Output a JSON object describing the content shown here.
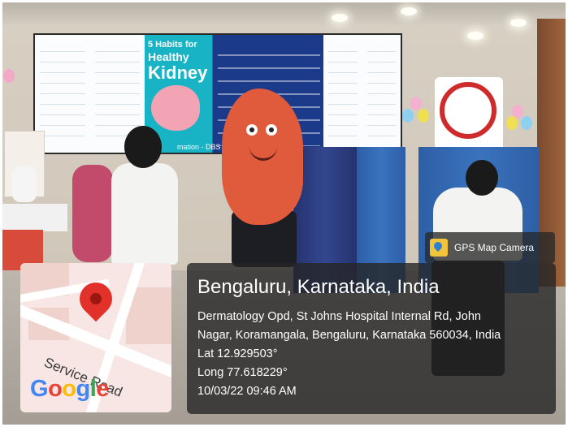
{
  "overlay": {
    "app_tag": {
      "logo_icon": "gps-map-camera-logo",
      "label": "GPS Map Camera"
    },
    "map": {
      "pin_icon": "map-pin-icon",
      "road_label": "Service Road",
      "brand": [
        {
          "ch": "G",
          "color": "#4285F4"
        },
        {
          "ch": "o",
          "color": "#EA4335"
        },
        {
          "ch": "o",
          "color": "#FBBC05"
        },
        {
          "ch": "g",
          "color": "#4285F4"
        },
        {
          "ch": "l",
          "color": "#34A853"
        },
        {
          "ch": "e",
          "color": "#EA4335"
        }
      ]
    },
    "location": {
      "title": "Bengaluru, Karnataka, India",
      "address_line1": "Dermatology Opd, St Johns Hospital Internal Rd, John",
      "address_line2": "Nagar, Koramangala, Bengaluru, Karnataka 560034, India",
      "latitude": "Lat 12.929503°",
      "longitude": "Long 77.618229°",
      "timestamp": "10/03/22 09:46 AM"
    }
  },
  "photo": {
    "poster_title_line1": "5 Habits for",
    "poster_title_line2": "Healthy",
    "poster_title_big": "Kidney",
    "poster_footer": "mation - DBS"
  }
}
